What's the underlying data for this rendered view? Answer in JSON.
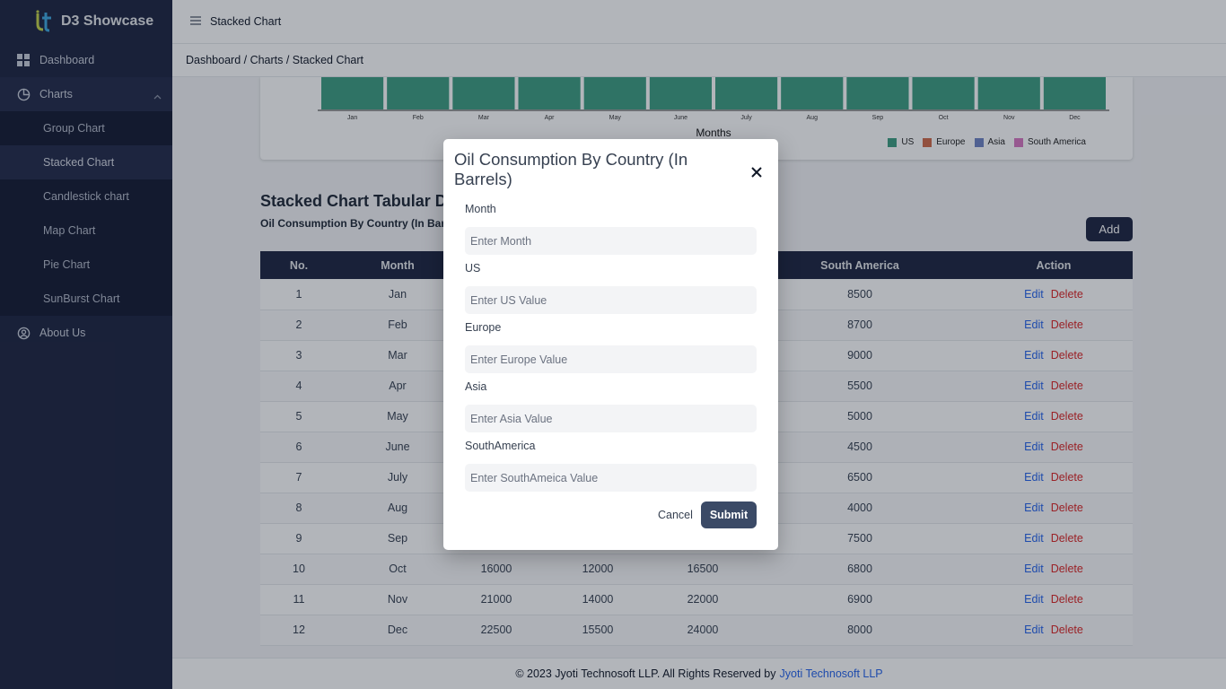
{
  "brand": {
    "title": "D3 Showcase"
  },
  "sidebar": {
    "items": [
      {
        "label": "Dashboard"
      },
      {
        "label": "Charts"
      },
      {
        "label": "About Us"
      }
    ],
    "chart_subitems": [
      {
        "label": "Group Chart"
      },
      {
        "label": "Stacked Chart"
      },
      {
        "label": "Candlestick chart"
      },
      {
        "label": "Map Chart"
      },
      {
        "label": "Pie Chart"
      },
      {
        "label": "SunBurst Chart"
      }
    ]
  },
  "topbar": {
    "title": "Stacked Chart"
  },
  "breadcrumb": {
    "text": "Dashboard / Charts / Stacked Chart"
  },
  "chart": {
    "months_label": "Months",
    "colors": {
      "US": "#3e9e82",
      "Europe": "#d06b4a",
      "Asia": "#6f84c4",
      "South America": "#d878c2"
    }
  },
  "chart_data": {
    "type": "bar",
    "categories": [
      "Jan",
      "Feb",
      "Mar",
      "Apr",
      "May",
      "June",
      "July",
      "Aug",
      "Sep",
      "Oct",
      "Nov",
      "Dec"
    ],
    "xlabel": "Months",
    "legend": [
      "US",
      "Europe",
      "Asia",
      "South America"
    ],
    "legend_position": "bottom-right"
  },
  "table_section": {
    "title": "Stacked Chart Tabular Da",
    "subtitle": "Oil Consumption By Country (In Barre",
    "add_label": "Add",
    "headers": [
      "No.",
      "Month",
      "",
      "",
      "",
      "South America",
      "Action"
    ],
    "rows": [
      {
        "no": "1",
        "month": "Jan",
        "us": "",
        "europe": "",
        "asia": "",
        "sa": "8500"
      },
      {
        "no": "2",
        "month": "Feb",
        "us": "",
        "europe": "",
        "asia": "",
        "sa": "8700"
      },
      {
        "no": "3",
        "month": "Mar",
        "us": "",
        "europe": "",
        "asia": "",
        "sa": "9000"
      },
      {
        "no": "4",
        "month": "Apr",
        "us": "",
        "europe": "",
        "asia": "",
        "sa": "5500"
      },
      {
        "no": "5",
        "month": "May",
        "us": "",
        "europe": "",
        "asia": "",
        "sa": "5000"
      },
      {
        "no": "6",
        "month": "June",
        "us": "",
        "europe": "",
        "asia": "",
        "sa": "4500"
      },
      {
        "no": "7",
        "month": "July",
        "us": "",
        "europe": "",
        "asia": "",
        "sa": "6500"
      },
      {
        "no": "8",
        "month": "Aug",
        "us": "",
        "europe": "",
        "asia": "",
        "sa": "4000"
      },
      {
        "no": "9",
        "month": "Sep",
        "us": "",
        "europe": "",
        "asia": "",
        "sa": "7500"
      },
      {
        "no": "10",
        "month": "Oct",
        "us": "16000",
        "europe": "12000",
        "asia": "16500",
        "sa": "6800"
      },
      {
        "no": "11",
        "month": "Nov",
        "us": "21000",
        "europe": "14000",
        "asia": "22000",
        "sa": "6900"
      },
      {
        "no": "12",
        "month": "Dec",
        "us": "22500",
        "europe": "15500",
        "asia": "24000",
        "sa": "8000"
      }
    ],
    "edit_label": "Edit",
    "delete_label": "Delete"
  },
  "footer": {
    "text": "© 2023 Jyoti Technosoft LLP. All Rights Reserved by",
    "link": "Jyoti Technosoft LLP"
  },
  "modal": {
    "title": "Oil Consumption By Country (In Barrels)",
    "fields": [
      {
        "label": "Month",
        "placeholder": "Enter Month"
      },
      {
        "label": "US",
        "placeholder": "Enter US Value"
      },
      {
        "label": "Europe",
        "placeholder": "Enter Europe Value"
      },
      {
        "label": "Asia",
        "placeholder": "Enter Asia Value"
      },
      {
        "label": "SouthAmerica",
        "placeholder": "Enter SouthAmeica Value"
      }
    ],
    "cancel_label": "Cancel",
    "submit_label": "Submit"
  }
}
